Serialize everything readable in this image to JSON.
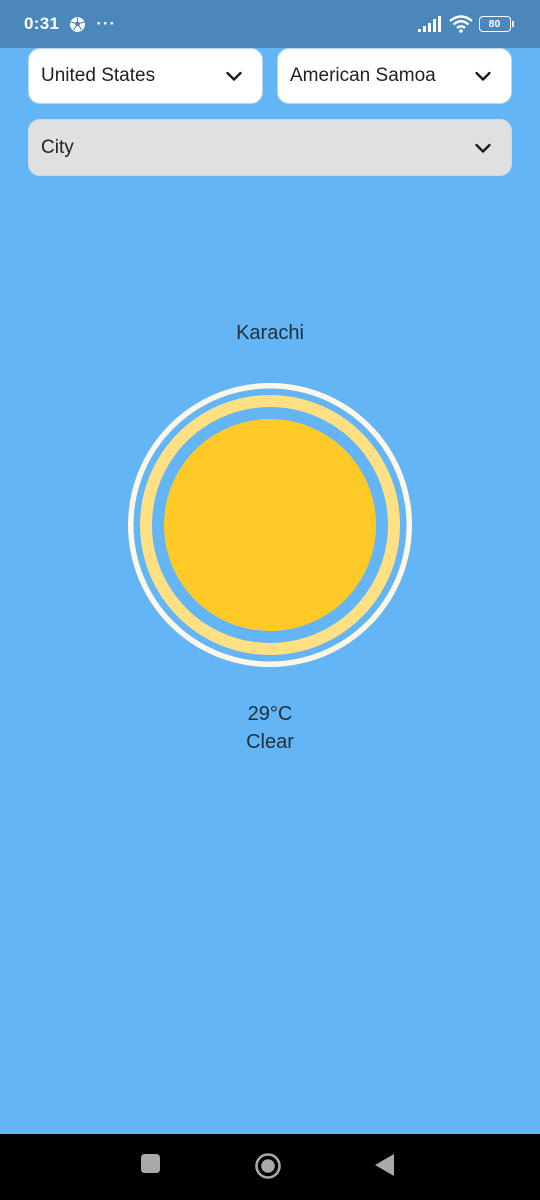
{
  "status_bar": {
    "time": "0:31",
    "more": "···",
    "battery": "80"
  },
  "selectors": {
    "country": {
      "value": "United States"
    },
    "state": {
      "value": "American Samoa"
    },
    "city": {
      "placeholder": "City"
    }
  },
  "weather": {
    "city": "Karachi",
    "temperature": "29°C",
    "condition": "Clear",
    "icon": "sun-icon"
  },
  "colors": {
    "background": "#64b5f6",
    "status_bar": "#4b87bb",
    "sun_core": "#ffca28",
    "sun_ring": "#ffe082",
    "sun_outer_ring": "#fff8e6"
  },
  "navigation": {
    "buttons": [
      "recents-icon",
      "home-icon",
      "back-icon"
    ]
  }
}
